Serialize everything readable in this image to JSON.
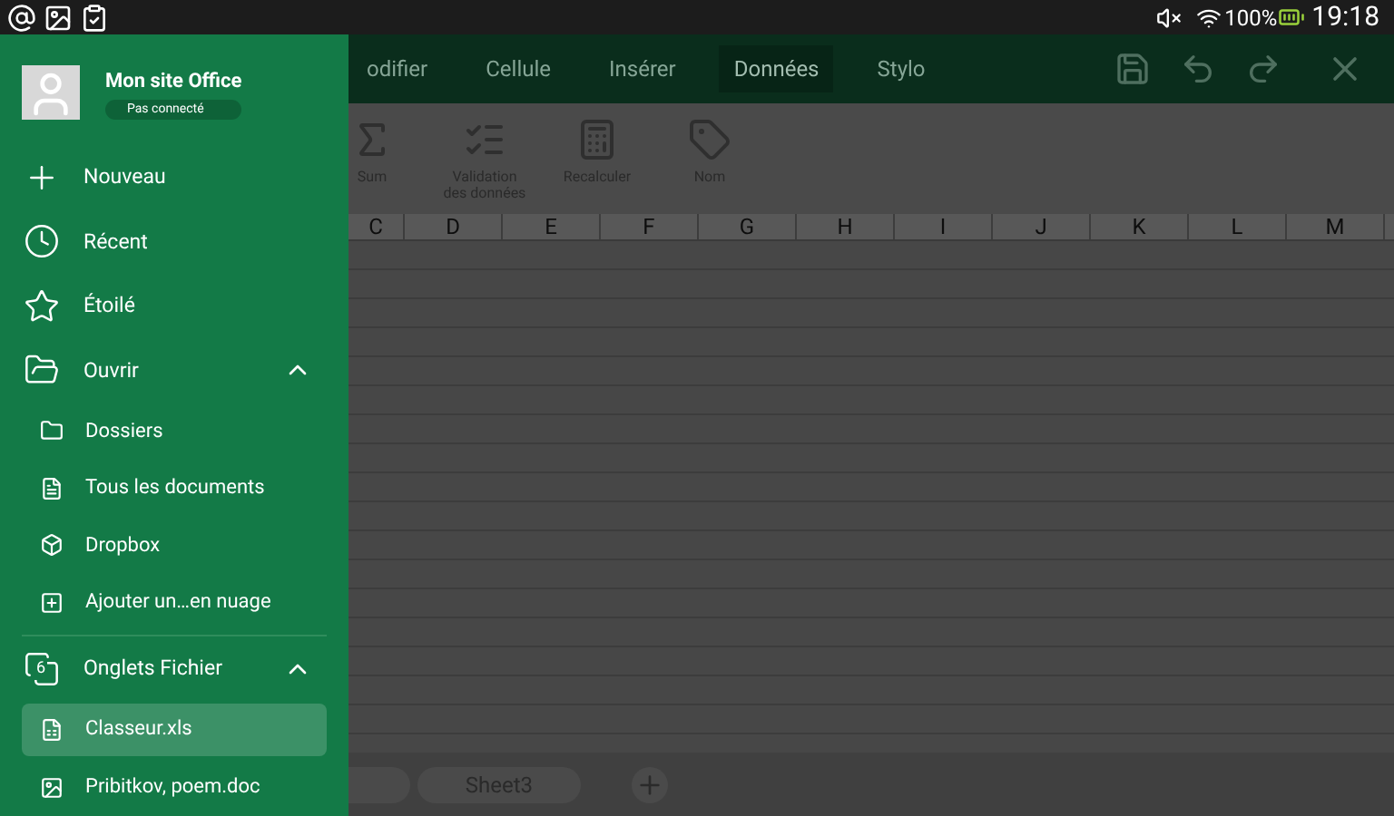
{
  "status_bar": {
    "battery": "100%",
    "time": "19:18"
  },
  "toolbar": {
    "tabs": [
      {
        "label": "odifier",
        "selected": false
      },
      {
        "label": "Cellule",
        "selected": false
      },
      {
        "label": "Insérer",
        "selected": false
      },
      {
        "label": "Données",
        "selected": true
      },
      {
        "label": "Stylo",
        "selected": false
      }
    ]
  },
  "ribbon": {
    "items": [
      {
        "kind": "sum",
        "label": "Sum"
      },
      {
        "kind": "validation",
        "label": "Validation des données"
      },
      {
        "kind": "recalc",
        "label": "Recalculer"
      },
      {
        "kind": "name",
        "label": "Nom"
      }
    ]
  },
  "sheet": {
    "columns": [
      "C",
      "D",
      "E",
      "F",
      "G",
      "H",
      "I",
      "J",
      "K",
      "L",
      "M"
    ],
    "tabs": [
      {
        "label": "Sheet3"
      }
    ]
  },
  "drawer": {
    "account": {
      "name": "Mon site Office",
      "status": "Pas connecté"
    },
    "items": [
      {
        "kind": "main",
        "label": "Nouveau"
      },
      {
        "kind": "main",
        "label": "Récent"
      },
      {
        "kind": "main",
        "label": "Étoilé"
      },
      {
        "kind": "section",
        "label": "Ouvrir",
        "expanded": true,
        "children": [
          {
            "label": "Dossiers",
            "selected": false
          },
          {
            "label": "Tous les documents",
            "selected": false
          },
          {
            "label": "Dropbox",
            "selected": false
          },
          {
            "label": "Ajouter un…en nuage",
            "selected": false
          }
        ]
      },
      {
        "kind": "section",
        "badge": "6",
        "label": "Onglets Fichier",
        "expanded": true,
        "children": [
          {
            "label": "Classeur.xls",
            "selected": true
          },
          {
            "label": "Pribitkov, poem.doc",
            "selected": false
          }
        ]
      }
    ]
  }
}
